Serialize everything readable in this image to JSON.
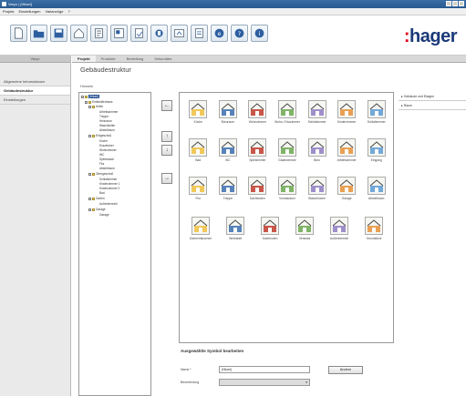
{
  "window": {
    "title": "Varyo | [Hikari]"
  },
  "menu": {
    "items": [
      "Projekt",
      "Einstellungen",
      "Varianzüge",
      "?"
    ]
  },
  "brand": {
    "logo_prefix": ":",
    "logo_text": "hager",
    "color_primary": "#1b3a7a",
    "color_accent": "#e2001a"
  },
  "sidebar": {
    "header": "Varyo",
    "items": [
      {
        "label": "Allgemeine Informationen"
      },
      {
        "label": "Gebäudestruktur"
      },
      {
        "label": "Einstellungen"
      }
    ]
  },
  "tabs": [
    "Projekt",
    "Produkte",
    "Bestellung",
    "Sekundäre"
  ],
  "main": {
    "heading": "Gebäudestruktur",
    "subheading": "Hinweis"
  },
  "tree": {
    "nodes": [
      {
        "label": "[Hikari]"
      },
      {
        "label": "Einfamilienhaus"
      },
      {
        "label": "Keller"
      },
      {
        "label": "Arbeitszimmer"
      },
      {
        "label": "Treppe"
      },
      {
        "label": "Heizraum"
      },
      {
        "label": "Waschkeller"
      },
      {
        "label": "Abstellraum"
      },
      {
        "label": "Erdgeschoß"
      },
      {
        "label": "Küche"
      },
      {
        "label": "Esszimmer"
      },
      {
        "label": "Wohnzimmer"
      },
      {
        "label": "WC"
      },
      {
        "label": "Speisesaal"
      },
      {
        "label": "Flur"
      },
      {
        "label": "Abstellraum"
      },
      {
        "label": "Obergeschoß"
      },
      {
        "label": "Schlafzimmer"
      },
      {
        "label": "Kinderzimmer 1"
      },
      {
        "label": "Kinderzimmer 2"
      },
      {
        "label": "Bad"
      },
      {
        "label": "Garten"
      },
      {
        "label": "Außenbereich"
      },
      {
        "label": "Garage"
      },
      {
        "label": "Garage"
      }
    ]
  },
  "palette": {
    "symbols": [
      {
        "label": "Küche",
        "icon": "kitchen-icon"
      },
      {
        "label": "Büroraum",
        "icon": "office-icon"
      },
      {
        "label": "Wohnzimmer",
        "icon": "living-room-icon"
      },
      {
        "label": "Wohn-/ Esszimmer",
        "icon": "living-dining-icon"
      },
      {
        "label": "Schlafzimmer",
        "icon": "bedroom-icon"
      },
      {
        "label": "Kinderzimmer",
        "icon": "kids-room-icon"
      },
      {
        "label": "Schlafzimmer",
        "icon": "bedroom-2-icon"
      },
      {
        "label": "Bad",
        "icon": "bath-icon"
      },
      {
        "label": "WC",
        "icon": "wc-icon"
      },
      {
        "label": "Spielzimmer",
        "icon": "playroom-icon"
      },
      {
        "label": "Gästezimmer",
        "icon": "guest-room-icon"
      },
      {
        "label": "Büro",
        "icon": "desk-icon"
      },
      {
        "label": "Arbeitszimmer",
        "icon": "workroom-icon"
      },
      {
        "label": "Eingang",
        "icon": "entrance-icon"
      },
      {
        "label": "Flur",
        "icon": "hall-icon"
      },
      {
        "label": "Treppe",
        "icon": "stairs-icon"
      },
      {
        "label": "Dachboden",
        "icon": "attic-icon"
      },
      {
        "label": "Vorratsraum",
        "icon": "storage-icon"
      },
      {
        "label": "Waschküche",
        "icon": "laundry-icon"
      },
      {
        "label": "Garage",
        "icon": "garage-icon"
      },
      {
        "label": "Abstellraum",
        "icon": "closet-icon"
      },
      {
        "label": "Gartenhäuschen",
        "icon": "garden-house-icon"
      },
      {
        "label": "Werkstatt",
        "icon": "workshop-icon"
      },
      {
        "label": "Dachboden",
        "icon": "roof-icon"
      },
      {
        "label": "Veranda",
        "icon": "veranda-icon"
      },
      {
        "label": "Außenbereich",
        "icon": "outdoor-icon"
      },
      {
        "label": "Grundstück",
        "icon": "plot-icon"
      }
    ]
  },
  "right_panel": {
    "items": [
      {
        "label": "Gebäude und Etagen"
      },
      {
        "label": "Raum"
      }
    ]
  },
  "properties": {
    "title": "Ausgewählte Symbol bearbeiten",
    "name_label": "Name *",
    "name_value": "[Hikari]",
    "browse_label": "Ändern",
    "description_label": "Bezeichnung"
  }
}
